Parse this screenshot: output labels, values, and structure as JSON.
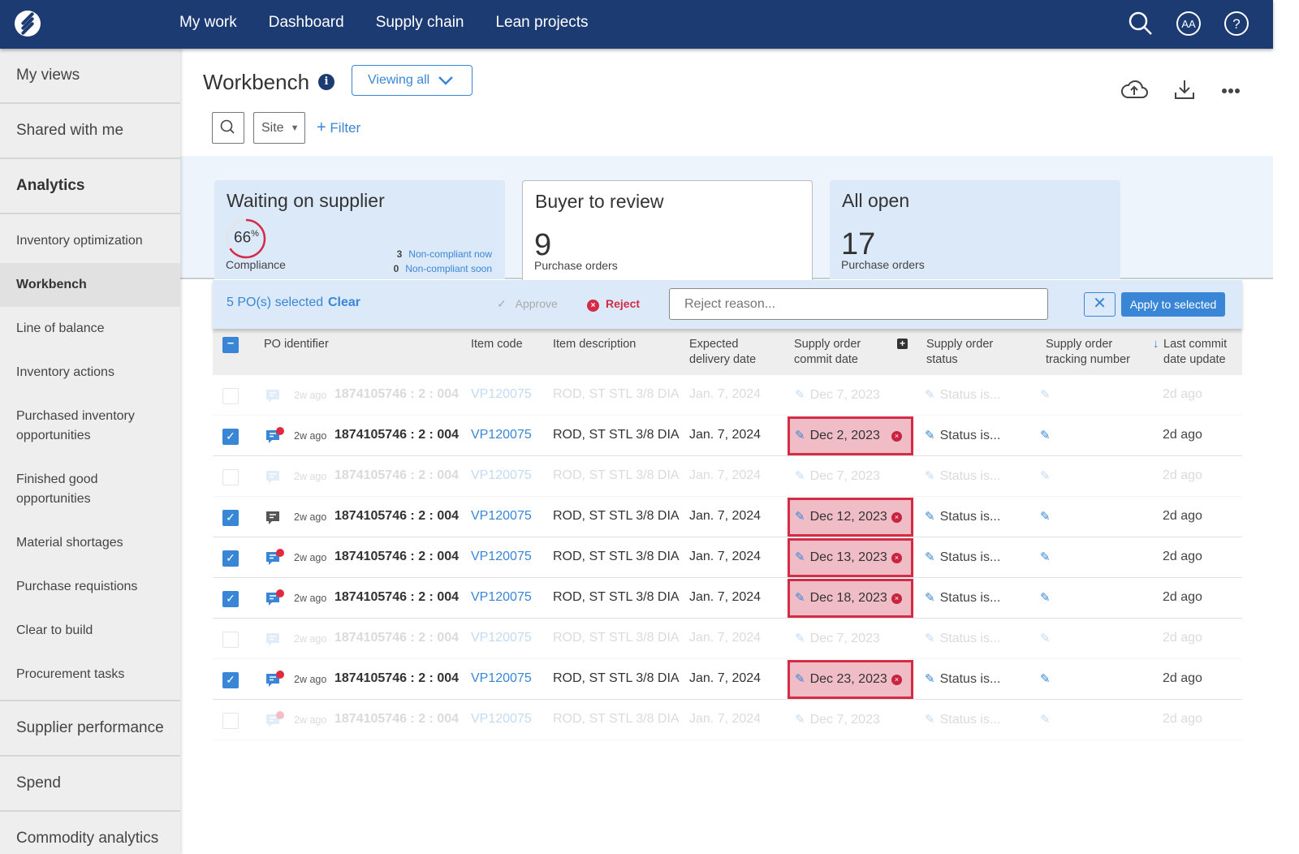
{
  "nav": {
    "items": [
      "My work",
      "Dashboard",
      "Supply chain",
      "Lean projects"
    ],
    "icons": [
      "search-icon",
      "accessibility-text-icon",
      "help-icon"
    ]
  },
  "sidebar": {
    "top": [
      "My views",
      "Shared with me"
    ],
    "section": "Analytics",
    "items": [
      "Inventory optimization",
      "Workbench",
      "Line of balance",
      "Inventory actions",
      "Purchased inventory opportunities",
      "Finished good opportunities",
      "Material shortages",
      "Purchase requistions",
      "Clear to build",
      "Procurement tasks"
    ],
    "bottom": [
      "Supplier performance",
      "Spend",
      "Commodity analytics"
    ],
    "active": "Workbench"
  },
  "header": {
    "title": "Workbench",
    "viewing": "Viewing all",
    "site": "Site",
    "filter": "Filter"
  },
  "cards": [
    {
      "title": "Waiting on supplier",
      "compliance_pct": "66",
      "pct_sign": "%",
      "compliance_label": "Compliance",
      "now_count": "3",
      "now_label": "Non-compliant now",
      "soon_count": "0",
      "soon_label": "Non-compliant soon"
    },
    {
      "title": "Buyer to review",
      "count": "9",
      "label": "Purchase orders"
    },
    {
      "title": "All open",
      "count": "17",
      "label": "Purchase orders"
    }
  ],
  "selection": {
    "text": "5 PO(s) selected",
    "clear": "Clear",
    "approve": "Approve",
    "reject": "Reject",
    "reason_placeholder": "Reject reason...",
    "apply": "Apply to selected"
  },
  "columns": [
    "PO identifier",
    "Item code",
    "Item description",
    "Expected delivery date",
    "Supply order commit date",
    "Supply order status",
    "Supply order tracking number",
    "Last commit date update"
  ],
  "colors": {
    "accent": "#3a86d6",
    "topbar": "#1b3b72",
    "error": "#d42b47",
    "error_bg": "#f0bcc6"
  },
  "rows": [
    {
      "checked": false,
      "unread": false,
      "age": "2w ago",
      "po": "1874105746 : 2 : 004",
      "item": "VP120075",
      "desc": "ROD, ST STL 3/8 DIA",
      "expected": "Jan. 7, 2024",
      "commit": "Dec 7, 2023",
      "error": false,
      "status": "Status is...",
      "last": "2d ago"
    },
    {
      "checked": true,
      "unread": true,
      "age": "2w ago",
      "po": "1874105746 : 2 : 004",
      "item": "VP120075",
      "desc": "ROD, ST STL 3/8 DIA",
      "expected": "Jan. 7, 2024",
      "commit": "Dec 2, 2023",
      "error": true,
      "status": "Status is...",
      "last": "2d ago"
    },
    {
      "checked": false,
      "unread": false,
      "age": "2w ago",
      "po": "1874105746 : 2 : 004",
      "item": "VP120075",
      "desc": "ROD, ST STL 3/8 DIA",
      "expected": "Jan. 7, 2024",
      "commit": "Dec 7, 2023",
      "error": false,
      "status": "Status is...",
      "last": "2d ago"
    },
    {
      "checked": true,
      "unread": false,
      "age": "2w ago",
      "po": "1874105746 : 2 : 004",
      "item": "VP120075",
      "desc": "ROD, ST STL 3/8 DIA",
      "expected": "Jan. 7, 2024",
      "commit": "Dec 12, 2023",
      "error": true,
      "status": "Status is...",
      "last": "2d ago"
    },
    {
      "checked": true,
      "unread": true,
      "age": "2w ago",
      "po": "1874105746 : 2 : 004",
      "item": "VP120075",
      "desc": "ROD, ST STL 3/8 DIA",
      "expected": "Jan. 7, 2024",
      "commit": "Dec 13, 2023",
      "error": true,
      "status": "Status is...",
      "last": "2d ago"
    },
    {
      "checked": true,
      "unread": true,
      "age": "2w ago",
      "po": "1874105746 : 2 : 004",
      "item": "VP120075",
      "desc": "ROD, ST STL 3/8 DIA",
      "expected": "Jan. 7, 2024",
      "commit": "Dec 18, 2023",
      "error": true,
      "status": "Status is...",
      "last": "2d ago"
    },
    {
      "checked": false,
      "unread": false,
      "age": "2w ago",
      "po": "1874105746 : 2 : 004",
      "item": "VP120075",
      "desc": "ROD, ST STL 3/8 DIA",
      "expected": "Jan. 7, 2024",
      "commit": "Dec 7, 2023",
      "error": false,
      "status": "Status is...",
      "last": "2d ago"
    },
    {
      "checked": true,
      "unread": true,
      "age": "2w ago",
      "po": "1874105746 : 2 : 004",
      "item": "VP120075",
      "desc": "ROD, ST STL 3/8 DIA",
      "expected": "Jan. 7, 2024",
      "commit": "Dec 23, 2023",
      "error": true,
      "status": "Status is...",
      "last": "2d ago"
    },
    {
      "checked": false,
      "unread": true,
      "age": "2w ago",
      "po": "1874105746 : 2 : 004",
      "item": "VP120075",
      "desc": "ROD, ST STL 3/8 DIA",
      "expected": "Jan. 7, 2024",
      "commit": "Dec 7, 2023",
      "error": false,
      "status": "Status is...",
      "last": "2d ago"
    }
  ]
}
